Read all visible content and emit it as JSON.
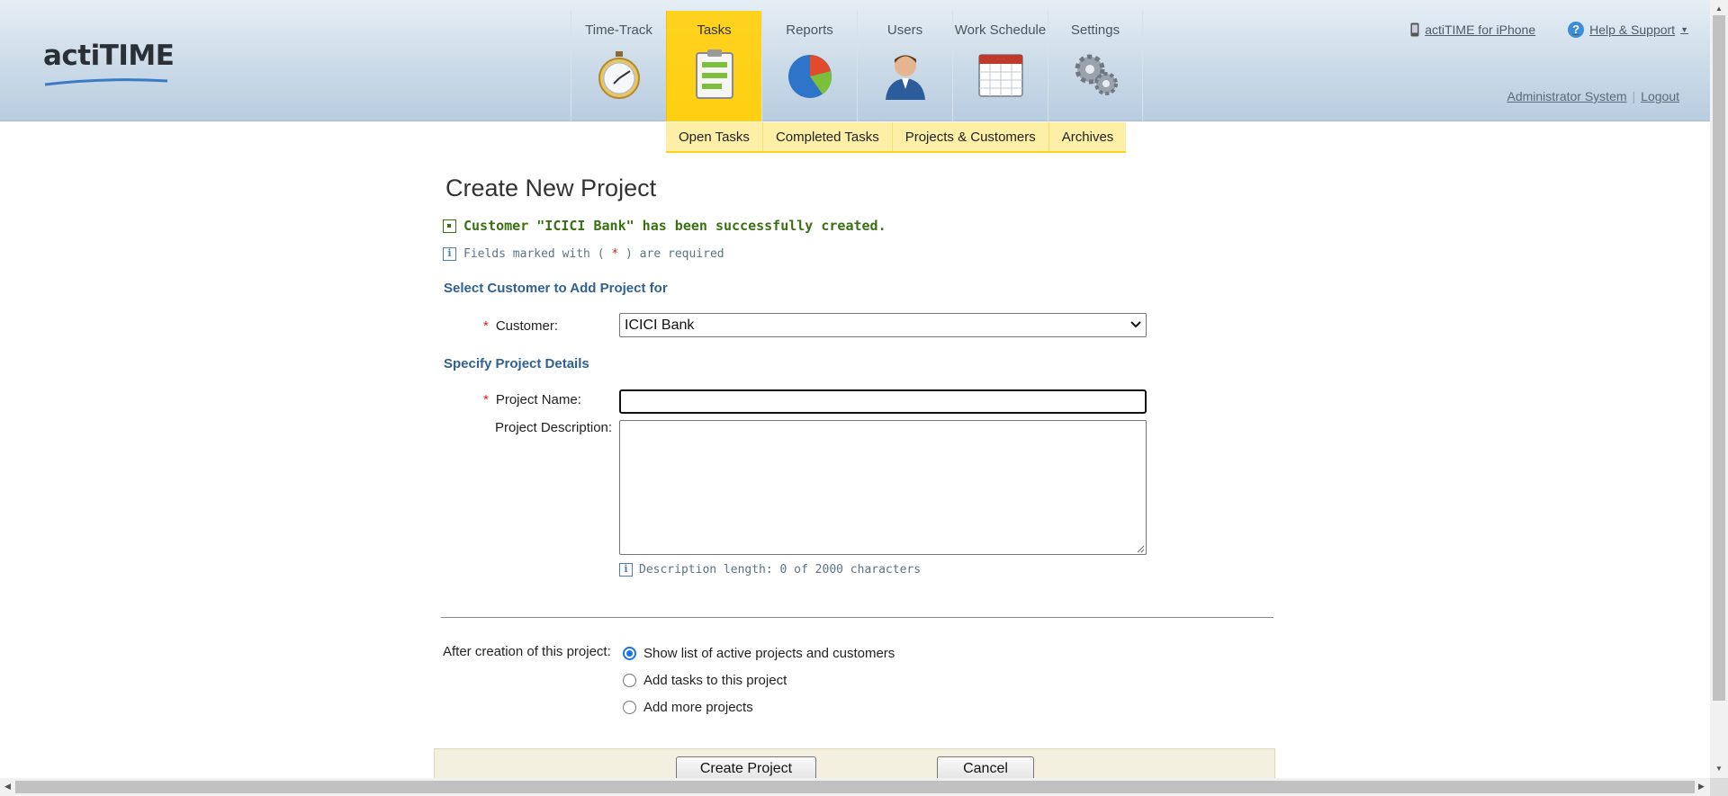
{
  "app": {
    "logo_text": "actiTIME"
  },
  "nav": {
    "items": [
      {
        "label": "Time-Track",
        "icon": "stopwatch-icon",
        "active": false
      },
      {
        "label": "Tasks",
        "icon": "clipboard-icon",
        "active": true
      },
      {
        "label": "Reports",
        "icon": "pie-chart-icon",
        "active": false
      },
      {
        "label": "Users",
        "icon": "user-icon",
        "active": false
      },
      {
        "label": "Work Schedule",
        "icon": "calendar-icon",
        "active": false
      },
      {
        "label": "Settings",
        "icon": "gears-icon",
        "active": false
      }
    ]
  },
  "top_links": {
    "iphone": "actiTIME for iPhone",
    "help": "Help & Support"
  },
  "user": {
    "name": "Administrator System",
    "logout": "Logout"
  },
  "subnav": [
    "Open Tasks",
    "Completed Tasks",
    "Projects & Customers",
    "Archives"
  ],
  "form": {
    "title": "Create New Project",
    "success_message": "Customer \"ICICI Bank\" has been successfully created.",
    "required_note_prefix": "Fields marked with (",
    "required_note_star": "*",
    "required_note_suffix": ") are required",
    "section_customer": "Select Customer to Add Project for",
    "customer_label": "Customer:",
    "customer_value": "ICICI Bank",
    "section_details": "Specify Project Details",
    "project_name_label": "Project Name:",
    "project_name_value": "",
    "project_description_label": "Project Description:",
    "project_description_value": "",
    "description_length": "Description length: 0 of 2000 characters",
    "after_creation_label": "After creation of this project:",
    "after_options": [
      {
        "label": "Show list of active projects and customers",
        "checked": true
      },
      {
        "label": "Add tasks to this project",
        "checked": false
      },
      {
        "label": "Add more projects",
        "checked": false
      }
    ],
    "create_button": "Create Project",
    "cancel_button": "Cancel"
  },
  "colors": {
    "accent_yellow": "#ffd21f",
    "section_blue": "#2f6192",
    "success_green": "#3a7012",
    "required_red": "#d91e1e"
  }
}
